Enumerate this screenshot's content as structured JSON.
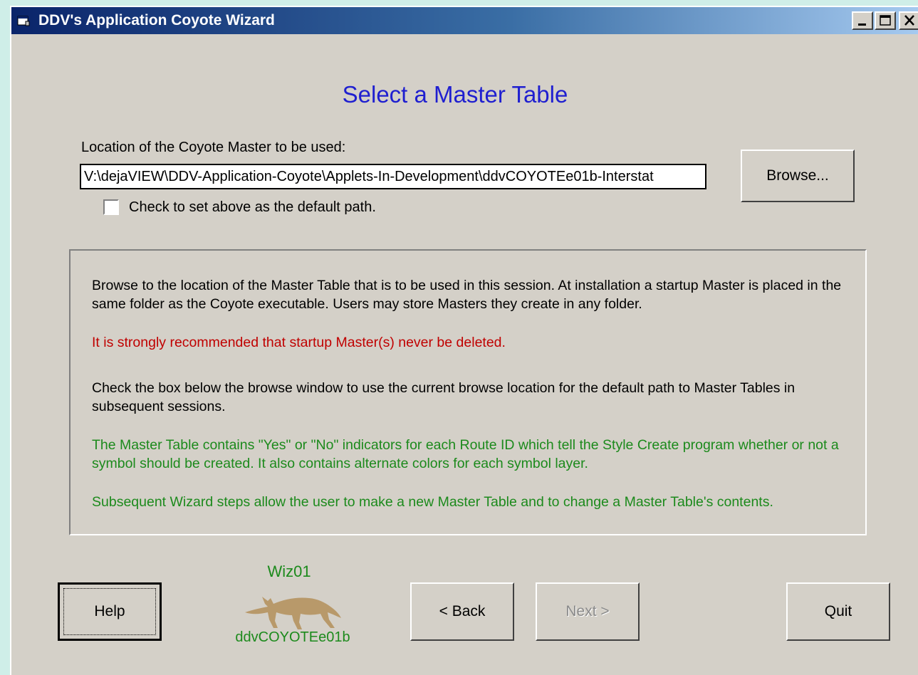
{
  "window": {
    "title": "DDV's Application Coyote Wizard",
    "controls": [
      "minimize",
      "maximize",
      "close"
    ]
  },
  "page": {
    "heading": "Select a Master Table",
    "location_label": "Location of the Coyote Master to be used:",
    "path_value": "V:\\dejaVIEW\\DDV-Application-Coyote\\Applets-In-Development\\ddvCOYOTEe01b-Interstat",
    "browse_label": "Browse...",
    "default_checkbox_label": "Check to set above as the default path.",
    "default_checked": false
  },
  "info": {
    "p1": "Browse to the location of the Master Table that is to be used in this session.  At installation a startup Master is placed in the same folder as the Coyote executable.  Users may store Masters they create in any folder.",
    "p2": "It is strongly recommended that startup Master(s) never be deleted.",
    "p3": "Check the box below the browse window to use the current browse location for the default path to Master Tables in subsequent sessions.",
    "p4": "The Master Table contains \"Yes\" or \"No\" indicators for each Route ID which tell the Style Create program whether or not a symbol should be created.  It also contains alternate colors for each symbol layer.",
    "p5": "Subsequent Wizard steps allow the user to make a new Master Table and to change a Master Table's contents."
  },
  "footer": {
    "help_label": "Help",
    "wizard_step": "Wiz01",
    "applet_name": "ddvCOYOTEe01b",
    "back_label": "< Back",
    "next_label": "Next >",
    "next_enabled": false,
    "quit_label": "Quit"
  },
  "colors": {
    "heading": "#1f1fd0",
    "warning": "#c00000",
    "info_green": "#1c8a1c",
    "dialog_bg": "#d4d0c8",
    "desktop_bg": "#cfeee8"
  },
  "icons": {
    "app": "app-window-icon",
    "mascot": "coyote-icon"
  }
}
